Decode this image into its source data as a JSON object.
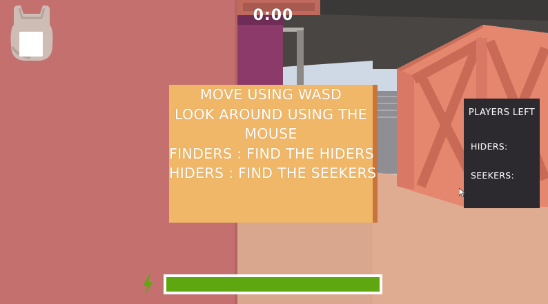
{
  "hud": {
    "timer": "0:00",
    "instructions": [
      "MOVE USING WASD",
      "LOOK AROUND USING THE",
      "MOUSE",
      "FINDERS : FIND THE HIDERS",
      "HIDERS : FIND THE SEEKERS"
    ],
    "players_panel": {
      "title": "PLAYERS LEFT",
      "hiders_label": "HIDERS:",
      "seekers_label": "SEEKERS:"
    },
    "stamina": {
      "level": 1.0,
      "icon": "lightning-bolt-icon"
    },
    "inventory": {
      "icon": "backpack-icon",
      "slot": "empty"
    }
  },
  "colors": {
    "wall": "#c4706f",
    "crate": "#e5866f",
    "ground": "#d9a68e",
    "panel_bg": "#efb767",
    "panel_border": "#c9743a",
    "players_bg": "#2c2a2e",
    "stamina_fill": "#5fa711",
    "text": "#ffffff"
  }
}
